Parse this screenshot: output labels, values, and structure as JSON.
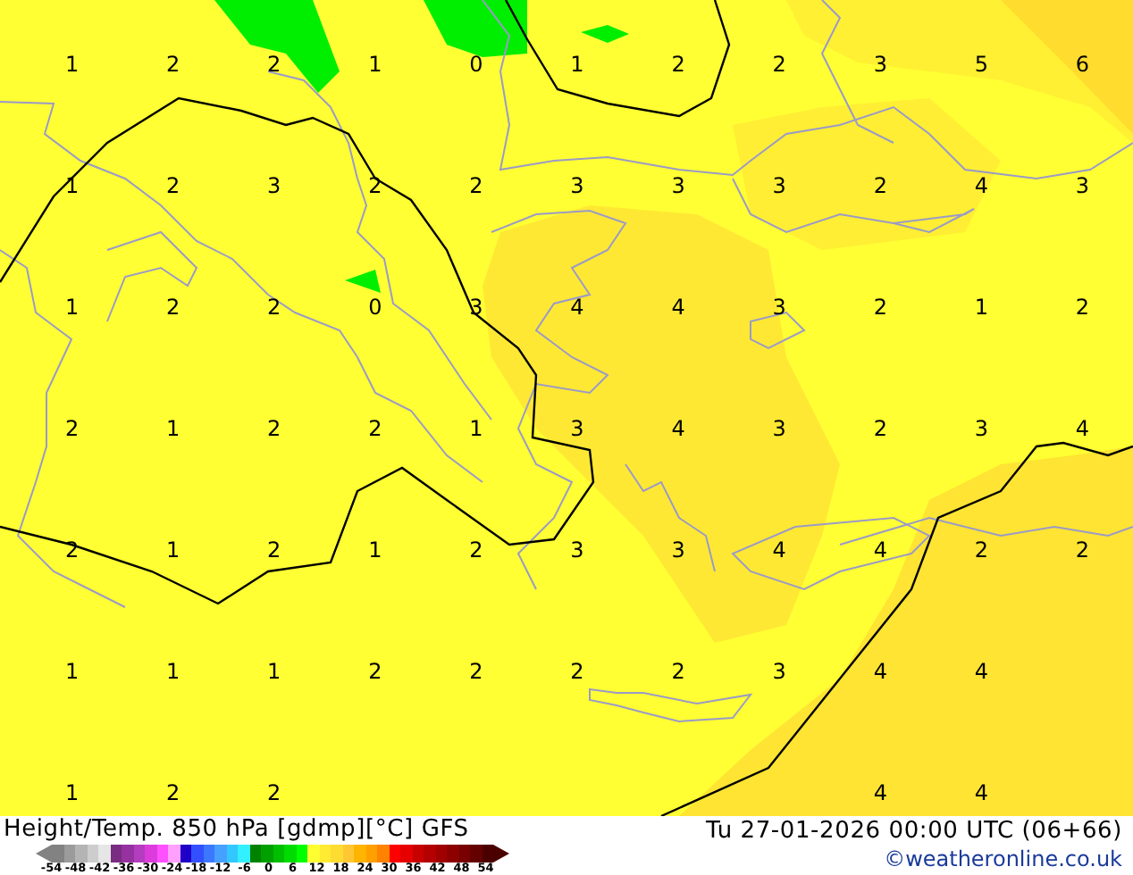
{
  "map": {
    "label_rows": [
      [
        "1",
        "2",
        "2",
        "1",
        "0",
        "1",
        "2",
        "2",
        "3",
        "5",
        "6"
      ],
      [
        "1",
        "2",
        "3",
        "2",
        "2",
        "3",
        "3",
        "3",
        "2",
        "4",
        "3"
      ],
      [
        "1",
        "2",
        "2",
        "0",
        "3",
        "4",
        "4",
        "3",
        "2",
        "1",
        "2"
      ],
      [
        "2",
        "1",
        "2",
        "2",
        "1",
        "3",
        "4",
        "3",
        "2",
        "3",
        "4"
      ],
      [
        "2",
        "1",
        "2",
        "1",
        "2",
        "3",
        "3",
        "4",
        "4",
        "2",
        "2"
      ],
      [
        "1",
        "1",
        "1",
        "2",
        "2",
        "2",
        "2",
        "3",
        "4",
        "4",
        null
      ],
      [
        "1",
        "2",
        "2",
        null,
        null,
        null,
        null,
        null,
        "4",
        "4",
        null
      ]
    ]
  },
  "footer": {
    "title": "Height/Temp. 850 hPa [gdmp][°C] GFS",
    "datetime": "Tu 27-01-2026 00:00 UTC (06+66)",
    "credit": "©weatheronline.co.uk"
  },
  "legend": {
    "swatches": [
      {
        "color": "#828282"
      },
      {
        "color": "#9b9b9b"
      },
      {
        "color": "#b4b4b4"
      },
      {
        "color": "#cdcdcd"
      },
      {
        "color": "#e6e6e6"
      },
      {
        "color": "#7a2b82"
      },
      {
        "color": "#9632a0"
      },
      {
        "color": "#b43cbe"
      },
      {
        "color": "#dc3cdc"
      },
      {
        "color": "#ff50ff"
      },
      {
        "color": "#ffa0ff"
      },
      {
        "color": "#1e00c8"
      },
      {
        "color": "#3250ff"
      },
      {
        "color": "#3c78ff"
      },
      {
        "color": "#46a0ff"
      },
      {
        "color": "#32c8ff"
      },
      {
        "color": "#32f0ff"
      },
      {
        "color": "#008200"
      },
      {
        "color": "#00a000"
      },
      {
        "color": "#00be00"
      },
      {
        "color": "#00dc00"
      },
      {
        "color": "#00ff00"
      },
      {
        "color": "#ffff32"
      },
      {
        "color": "#ffeb32"
      },
      {
        "color": "#ffdc32"
      },
      {
        "color": "#ffc832"
      },
      {
        "color": "#ffb400"
      },
      {
        "color": "#ffa000"
      },
      {
        "color": "#ff8200"
      },
      {
        "color": "#ff0000"
      },
      {
        "color": "#e60000"
      },
      {
        "color": "#c80000"
      },
      {
        "color": "#b40000"
      },
      {
        "color": "#a00000"
      },
      {
        "color": "#8c0000"
      },
      {
        "color": "#780000"
      },
      {
        "color": "#640000"
      },
      {
        "color": "#4b0000"
      }
    ],
    "ticks": [
      "-54",
      "-48",
      "-42",
      "-36",
      "-30",
      "-24",
      "-18",
      "-12",
      "-6",
      "0",
      "6",
      "12",
      "18",
      "24",
      "30",
      "36",
      "42",
      "48",
      "54"
    ]
  }
}
